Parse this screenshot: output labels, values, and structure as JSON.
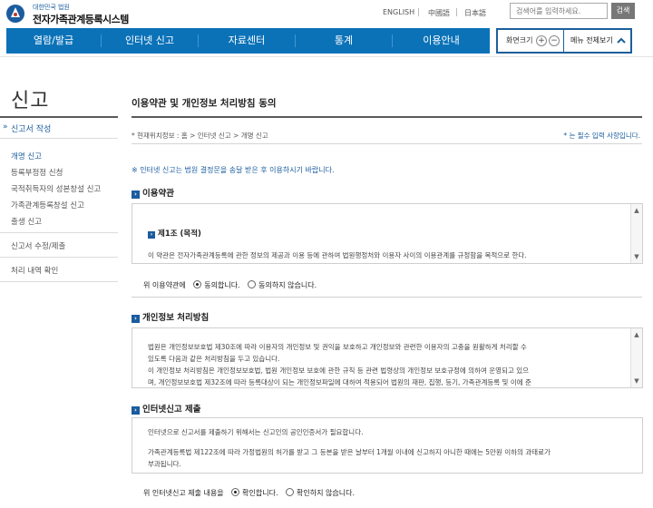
{
  "header": {
    "logo_sub": "대한민국 법원",
    "logo_title": "전자가족관계등록시스템",
    "languages": [
      "ENGLISH",
      "中國語",
      "日本語"
    ],
    "search_placeholder": "검색어를 입력하세요.",
    "search_button": "검색"
  },
  "gnb": {
    "items": [
      "열람/발급",
      "인터넷 신고",
      "자료센터",
      "통계",
      "이용안내"
    ]
  },
  "util": {
    "zoom_label": "화면크기",
    "zoom_in": "+",
    "zoom_out": "−",
    "menu_all": "메뉴 전체보기"
  },
  "sidebar": {
    "title": "신고",
    "section": "신고서 작성",
    "section_arrow": "»",
    "subitems": [
      {
        "label": "개명 신고",
        "active": true
      },
      {
        "label": "등록부정정 신청",
        "active": false
      },
      {
        "label": "국적취득자의 성본창설 신고",
        "active": false
      },
      {
        "label": "가족관계등록창설 신고",
        "active": false
      },
      {
        "label": "출생 신고",
        "active": false
      }
    ],
    "items": [
      "신고서 수정/제출",
      "처리 내역 확인"
    ]
  },
  "main": {
    "page_title": "이용약관 및 개인정보 처리방침 동의",
    "breadcrumb": "* 현재위치정보 : 홈 > 인터넷 신고 > 개명 신고",
    "required_note": "* 는 필수 입력 사항입니다.",
    "notice": "※ 인터넷 신고는 법원 결정문을 송달 받은 후 이용하시기 바랍니다."
  },
  "terms": {
    "heading": "이용약관",
    "article_title": "제1조 (목적)",
    "article_body": "이 약관은 전자가족관계등록에 관한 정보의 제공과 이용 등에 관하여 법원행정처와 이용자 사이의 이용관계를 규정함을 목적으로 한다.",
    "agree_prefix": "위 이용약관에",
    "agree_yes": "동의합니다.",
    "agree_no": "동의하지 않습니다."
  },
  "privacy": {
    "heading": "개인정보 처리방침",
    "lines": [
      "법원은 개인정보보호법 제30조에 따라 이용자의 개인정보 및 권익을 보호하고 개인정보와 관련한 이용자의 고충을 원활하게 처리할 수",
      "있도록 다음과 같은 처리방침을 두고 있습니다.",
      "이 개인정보 처리방침은 개인정보보호법, 법원 개인정보 보호에 관한 규칙 등 관련 법령상의 개인정보 보호규정에 의하여 운영되고 있으",
      "며, 개인정보보호법 제32조에 따라 등록대상이 되는 개인정보파일에 대하여 적용되어 법원의 재판, 집행, 등기, 가족관계등록 및 이에 준"
    ]
  },
  "submission": {
    "heading": "인터넷신고 제출",
    "line1": "인터넷으로 신고서를 제출하기 위해서는 신고인의 공인인증서가 필요합니다.",
    "line2": "가족관계등록법 제122조에 따라 가정법원의 허가를 받고 그 등본을 받은 날부터 1개월 이내에 신고하지 아니한 때에는 5만원 이하의 과태료가",
    "line3": "부과됩니다.",
    "confirm_prefix": "위 인터넷신고 제출 내용을",
    "confirm_yes": "확인합니다.",
    "confirm_no": "확인하지 않습니다."
  },
  "colors": {
    "primary": "#0b72b8",
    "accent": "#1a5c9e"
  }
}
